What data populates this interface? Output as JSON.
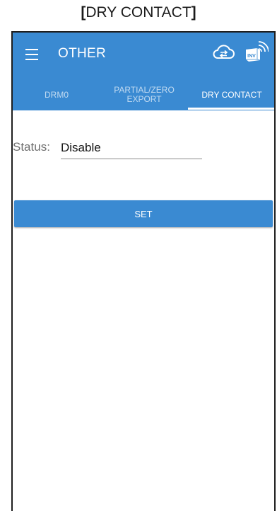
{
  "caption": {
    "open": "[",
    "text": "DRY CONTACT",
    "close": "]"
  },
  "appbar": {
    "title": "OTHER",
    "icons": [
      "menu-icon",
      "cloud-sync-icon",
      "inverter-wifi-icon"
    ],
    "inv_badge": "INV",
    "color": "#3a8ad2"
  },
  "tabs": [
    {
      "line1": "DRM0",
      "line2": ""
    },
    {
      "line1": "PARTIAL/ZERO",
      "line2": "EXPORT"
    },
    {
      "line1": "DRY CONTACT",
      "line2": ""
    }
  ],
  "active_tab": "DRY CONTACT",
  "form": {
    "status_label": "Status:",
    "status_value": "Disable"
  },
  "buttons": {
    "set_label": "SET"
  }
}
